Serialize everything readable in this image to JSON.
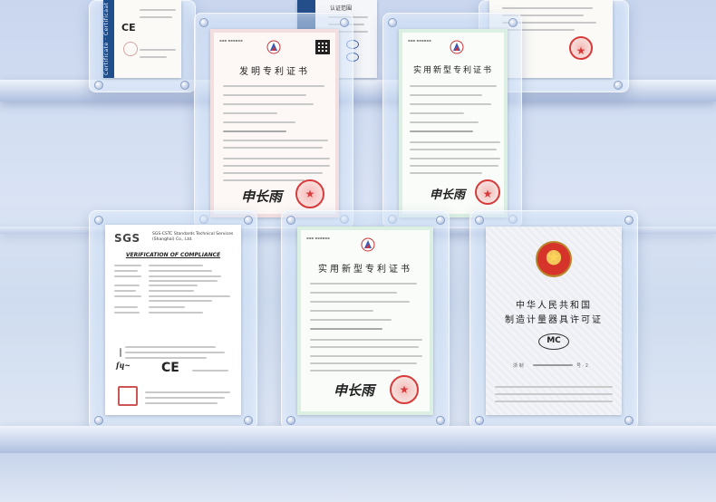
{
  "certificates": {
    "invention_patent": {
      "title": "发明专利证书",
      "signature": "申长雨"
    },
    "utility_patent_top": {
      "title": "实用新型专利证书",
      "signature": "申长雨"
    },
    "utility_patent_bottom": {
      "title": "实用新型专利证书",
      "signature": "申长雨"
    },
    "sgs": {
      "logo": "SGS",
      "header": "SGS-CSTC Standards Technical Services\n(Shanghai) Co., Ltd.",
      "verification": "VERIFICATION OF COMPLIANCE",
      "ce": "CE"
    },
    "metrology_license": {
      "country_line": "中华人民共和国",
      "license_line": "制造计量器具许可证",
      "mark": "MC",
      "number_prefix": "浙 制",
      "number_suffix": "号 · 2"
    },
    "top_left_ce": {
      "side_text": "Certificate · Certificaat",
      "ce": "CE"
    },
    "top_center_label": "认证范围"
  },
  "colors": {
    "background": "#d4def0",
    "shelf": "#cbd7ec",
    "seal_red": "#d83a3a",
    "frame_glass": "#d2e1f8"
  }
}
